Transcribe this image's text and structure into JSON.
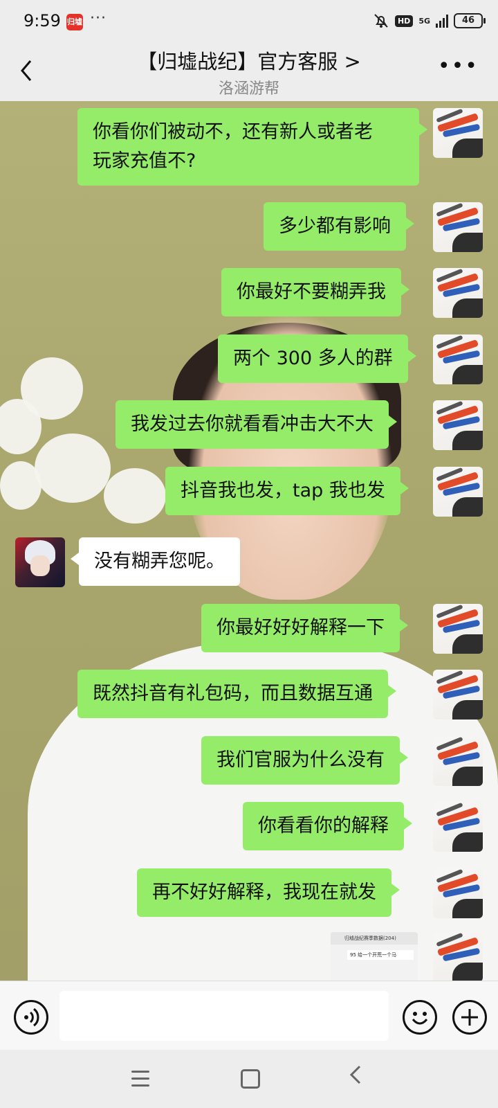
{
  "status_bar": {
    "time": "9:59",
    "app_icon_text": "归墟",
    "overflow": "···",
    "network": "5G",
    "hd": "HD",
    "battery": "46"
  },
  "header": {
    "back_icon": "chevron-left-icon",
    "title": "【归墟战纪】官方客服 >",
    "subtitle": "洛涵游帮",
    "more_icon": "more-horizontal-icon"
  },
  "messages": [
    {
      "from": "me",
      "line1": "你看你们被动不，还有新人或者老",
      "line2": "玩家充值不?"
    },
    {
      "from": "me",
      "text": "多少都有影响"
    },
    {
      "from": "me",
      "text": "你最好不要糊弄我"
    },
    {
      "from": "me",
      "text": "两个 300 多人的群"
    },
    {
      "from": "me",
      "text": "我发过去你就看看冲击大不大"
    },
    {
      "from": "me",
      "text": "抖音我也发，tap 我也发"
    },
    {
      "from": "them",
      "text": "没有糊弄您呢。"
    },
    {
      "from": "me",
      "text": "你最好好好解释一下"
    },
    {
      "from": "me",
      "text": "既然抖音有礼包码，而且数据互通"
    },
    {
      "from": "me",
      "text": "我们官服为什么没有"
    },
    {
      "from": "me",
      "text": "你看看你的解释"
    },
    {
      "from": "me",
      "text": "再不好好解释，我现在就发"
    }
  ],
  "image_message": {
    "header": "归墟战纪赛季数据(204)",
    "row": "95 给一个开荒一个马"
  },
  "input_bar": {
    "voice_icon": "voice-icon",
    "emoji_icon": "emoji-icon",
    "plus_icon": "plus-icon",
    "text_value": ""
  },
  "nav_bar": {
    "menu_icon": "menu-icon",
    "home_icon": "home-icon",
    "back_icon": "back-icon"
  },
  "colors": {
    "my_bubble": "#95ec69",
    "their_bubble": "#ffffff",
    "bar_background": "#ededed"
  }
}
